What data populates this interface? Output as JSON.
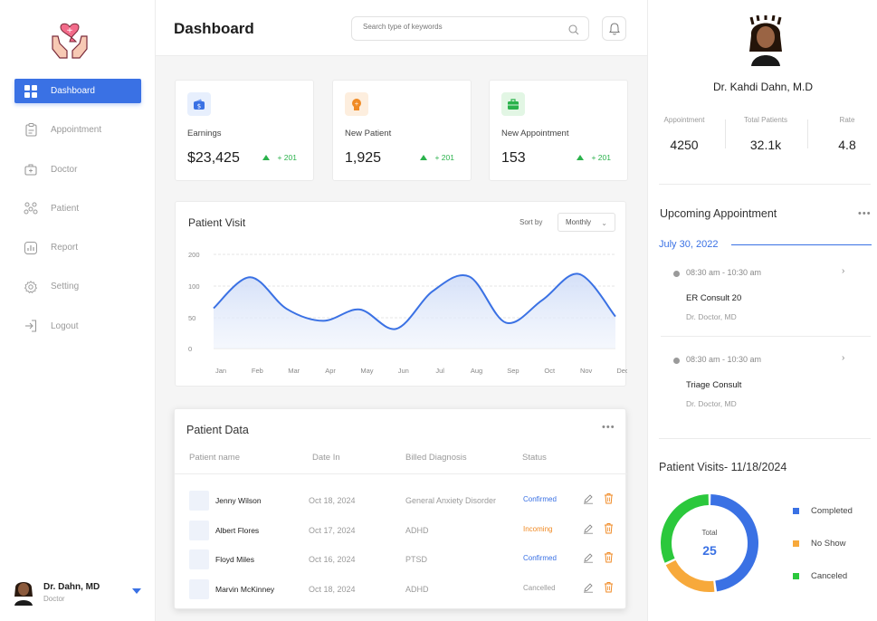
{
  "sidebar": {
    "items": [
      {
        "label": "Dashboard",
        "icon": "grid-icon",
        "active": true
      },
      {
        "label": "Appointment",
        "icon": "clipboard-icon"
      },
      {
        "label": "Doctor",
        "icon": "medical-bag-icon"
      },
      {
        "label": "Patient",
        "icon": "patients-icon"
      },
      {
        "label": "Report",
        "icon": "report-icon"
      },
      {
        "label": "Setting",
        "icon": "gear-icon"
      },
      {
        "label": "Logout",
        "icon": "logout-icon"
      }
    ],
    "user": {
      "name": "Dr. Dahn, MD",
      "role": "Doctor"
    }
  },
  "header": {
    "title": "Dashboard",
    "search_placeholder": "Search type of keywords"
  },
  "stats": [
    {
      "label": "Earnings",
      "value": "$23,425",
      "delta": "+ 201",
      "icon": "wallet-icon",
      "color": "#3a71e4"
    },
    {
      "label": "New Patient",
      "value": "1,925",
      "delta": "+ 201",
      "icon": "patient-head-icon",
      "color": "#f08a24"
    },
    {
      "label": "New Appointment",
      "value": "153",
      "delta": "+ 201",
      "icon": "briefcase-icon",
      "color": "#2bb24c"
    }
  ],
  "patient_visit": {
    "title": "Patient Visit",
    "sort_label": "Sort by",
    "sort_value": "Monthly"
  },
  "chart_data": {
    "type": "area",
    "title": "Patient Visit",
    "categories": [
      "Jan",
      "Feb",
      "Mar",
      "Apr",
      "May",
      "Jun",
      "Jul",
      "Aug",
      "Sep",
      "Oct",
      "Nov",
      "Dec"
    ],
    "values": [
      65,
      128,
      64,
      45,
      63,
      32,
      92,
      130,
      42,
      78,
      138,
      52
    ],
    "yticks": [
      0,
      50,
      100,
      200
    ],
    "grid": true,
    "color": "#3a71e4"
  },
  "patient_data": {
    "title": "Patient Data",
    "columns": [
      "Patient name",
      "Date In",
      "Billed Diagnosis",
      "Status"
    ],
    "rows": [
      {
        "name": "Jenny Wilson",
        "date": "Oct 18, 2024",
        "diagnosis": "General Anxiety Disorder",
        "status": "Confirmed",
        "status_color": "#3a71e4"
      },
      {
        "name": "Albert Flores",
        "date": "Oct 17, 2024",
        "diagnosis": "ADHD",
        "status": "Incoming",
        "status_color": "#f08a24"
      },
      {
        "name": "Floyd Miles",
        "date": "Oct 16, 2024",
        "diagnosis": "PTSD",
        "status": "Confirmed",
        "status_color": "#3a71e4"
      },
      {
        "name": "Marvin McKinney",
        "date": "Oct 18, 2024",
        "diagnosis": "ADHD",
        "status": "Cancelled",
        "status_color": "#9a9a9a"
      }
    ]
  },
  "doctor": {
    "name": "Dr. Kahdi Dahn, M.D",
    "stats": [
      {
        "label": "Appointment",
        "value": "4250"
      },
      {
        "label": "Total Patients",
        "value": "32.1k"
      },
      {
        "label": "Rate",
        "value": "4.8"
      }
    ]
  },
  "upcoming": {
    "title": "Upcoming Appointment",
    "date": "July 30, 2022",
    "items": [
      {
        "time": "08:30 am - 10:30 am",
        "name": "ER Consult 20",
        "doctor": "Dr. Doctor, MD"
      },
      {
        "time": "08:30 am - 10:30 am",
        "name": "Triage Consult",
        "doctor": "Dr. Doctor,  MD"
      }
    ]
  },
  "visits": {
    "title": "Patient Visits- 11/18/2024",
    "total_label": "Total",
    "total": "25",
    "legend": [
      {
        "label": "Completed",
        "color": "#3a71e4",
        "value": 12
      },
      {
        "label": "No Show",
        "color": "#f7a93b",
        "value": 5
      },
      {
        "label": "Canceled",
        "color": "#2bc83c",
        "value": 8
      }
    ]
  }
}
